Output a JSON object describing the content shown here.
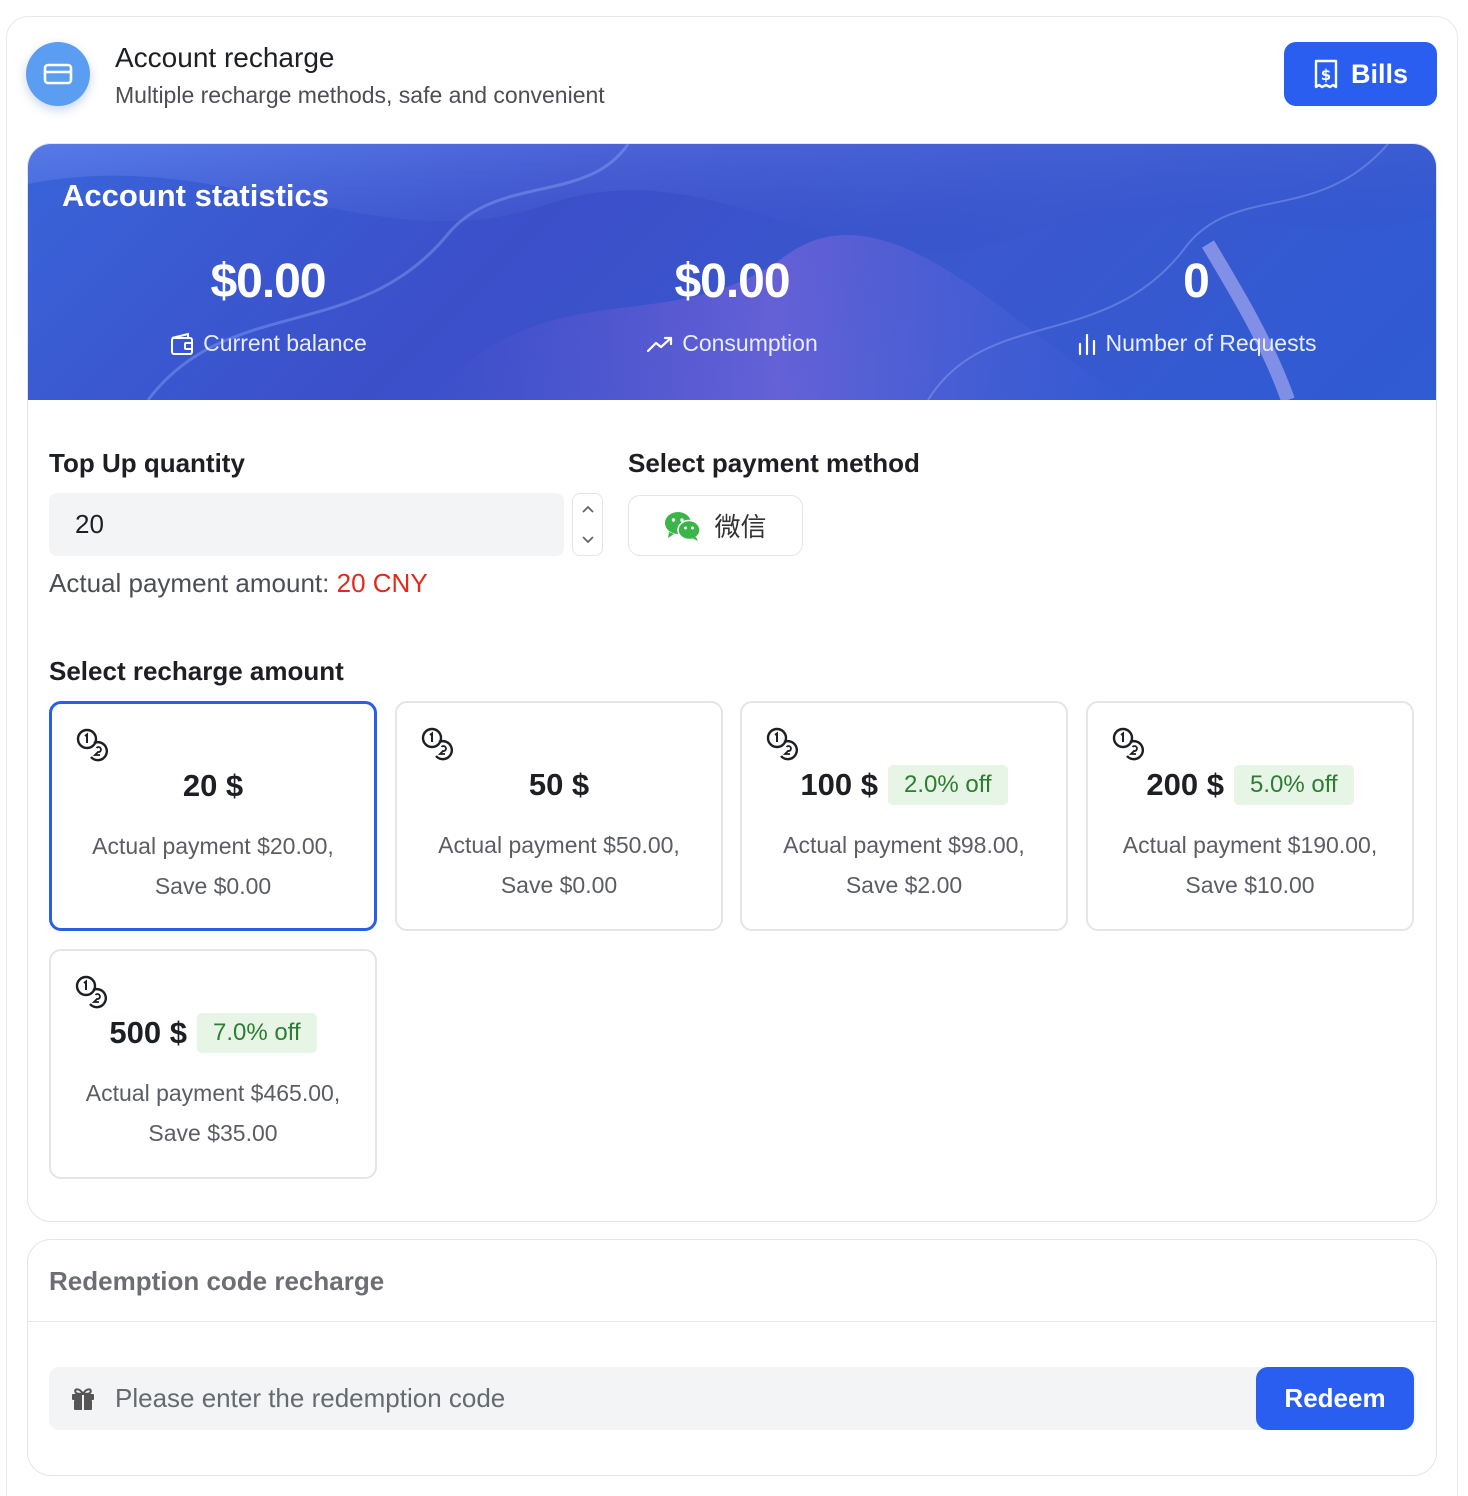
{
  "header": {
    "title": "Account recharge",
    "subtitle": "Multiple recharge methods, safe and convenient",
    "bills_label": "Bills"
  },
  "stats": {
    "title": "Account statistics",
    "items": [
      {
        "value": "$0.00",
        "label": "Current balance",
        "icon": "wallet-icon"
      },
      {
        "value": "$0.00",
        "label": "Consumption",
        "icon": "trend-up-icon"
      },
      {
        "value": "0",
        "label": "Number of Requests",
        "icon": "bar-chart-icon"
      }
    ]
  },
  "topup": {
    "label": "Top Up quantity",
    "value": "20",
    "payment_prefix": "Actual payment amount:",
    "payment_value": "20 CNY"
  },
  "payment": {
    "label": "Select payment method",
    "method": "微信",
    "icon": "wechat-icon"
  },
  "amounts": {
    "label": "Select recharge amount",
    "selected_index": 0,
    "items": [
      {
        "amount": "20 $",
        "discount": "",
        "line1": "Actual payment $20.00,",
        "line2": "Save $0.00"
      },
      {
        "amount": "50 $",
        "discount": "",
        "line1": "Actual payment $50.00,",
        "line2": "Save $0.00"
      },
      {
        "amount": "100 $",
        "discount": "2.0% off",
        "line1": "Actual payment $98.00,",
        "line2": "Save $2.00"
      },
      {
        "amount": "200 $",
        "discount": "5.0% off",
        "line1": "Actual payment $190.00,",
        "line2": "Save $10.00"
      },
      {
        "amount": "500 $",
        "discount": "7.0% off",
        "line1": "Actual payment $465.00,",
        "line2": "Save $35.00"
      }
    ]
  },
  "redeem": {
    "title": "Redemption code recharge",
    "placeholder": "Please enter the redemption code",
    "button": "Redeem"
  },
  "colors": {
    "accent": "#2a5ef0",
    "banner": "#3a58cf",
    "price_red": "#e5281a",
    "badge_bg": "#e6f5e6",
    "badge_text": "#2e7d32",
    "wechat_green": "#3bb54a"
  }
}
